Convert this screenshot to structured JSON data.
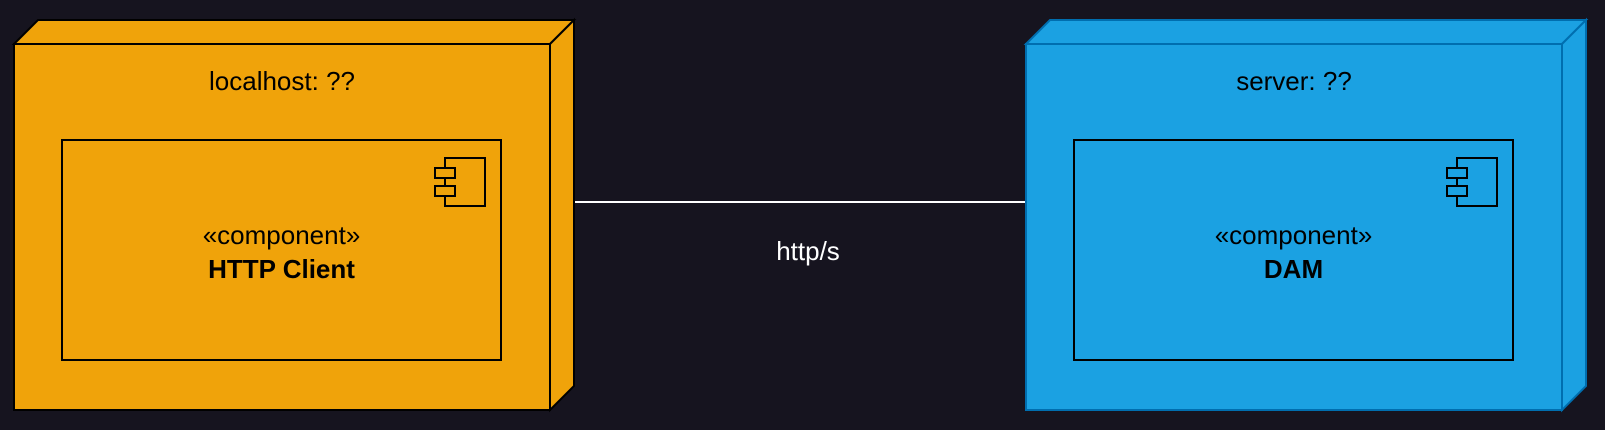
{
  "colors": {
    "background": "#16141f",
    "localhost_fill": "#f0a30a",
    "localhost_stroke": "#000000",
    "server_fill": "#1ba1e2",
    "server_stroke": "#006eaf",
    "connector": "#ffffff"
  },
  "nodes": [
    {
      "title": "localhost: ??",
      "component": {
        "stereotype": "«component»",
        "name": "HTTP Client",
        "icon": "component-icon"
      }
    },
    {
      "title": "server: ??",
      "component": {
        "stereotype": "«component»",
        "name": "DAM",
        "icon": "component-icon"
      }
    }
  ],
  "connector": {
    "label": "http/s"
  }
}
